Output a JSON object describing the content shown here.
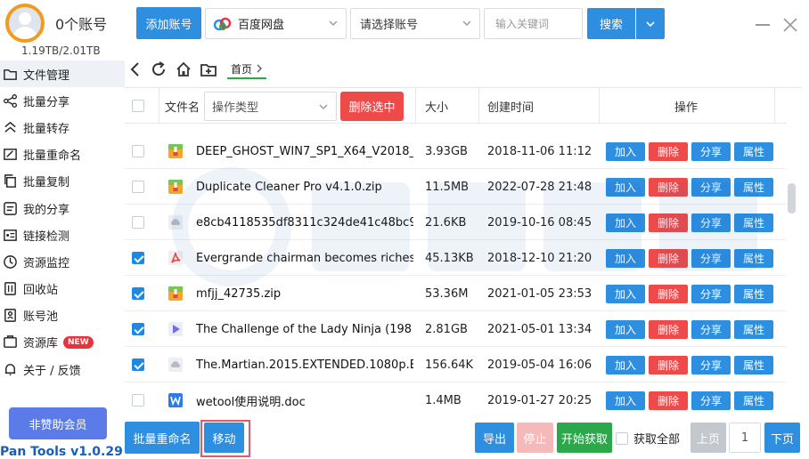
{
  "sidebar": {
    "account_count": "0个账号",
    "storage": "1.19TB/2.01TB",
    "items": [
      {
        "label": "文件管理",
        "icon": "folder-icon"
      },
      {
        "label": "批量分享",
        "icon": "share-icon"
      },
      {
        "label": "批量转存",
        "icon": "transfer-icon"
      },
      {
        "label": "批量重命名",
        "icon": "rename-icon"
      },
      {
        "label": "批量复制",
        "icon": "copy-icon"
      },
      {
        "label": "我的分享",
        "icon": "my-share-icon"
      },
      {
        "label": "链接检测",
        "icon": "link-check-icon"
      },
      {
        "label": "资源监控",
        "icon": "monitor-icon"
      },
      {
        "label": "回收站",
        "icon": "recycle-icon"
      },
      {
        "label": "账号池",
        "icon": "account-pool-icon"
      },
      {
        "label": "资源库",
        "icon": "library-icon",
        "badge": "NEW"
      },
      {
        "label": "关于 / 反馈",
        "icon": "bell-icon"
      }
    ],
    "vip_label": "非赞助会员",
    "version": "Pan Tools v1.0.29"
  },
  "toolbar": {
    "add_account": "添加账号",
    "cloud": "百度网盘",
    "account_placeholder": "请选择账号",
    "keyword_placeholder": "输入关键词",
    "search": "搜索"
  },
  "nav": {
    "breadcrumb": "首页"
  },
  "table": {
    "headers": {
      "filename": "文件名",
      "op_type": "操作类型",
      "delete_selected": "删除选中",
      "size": "大小",
      "created": "创建时间",
      "actions": "操作"
    },
    "action_labels": {
      "add": "加入",
      "delete": "删除",
      "share": "分享",
      "props": "属性"
    },
    "rows": [
      {
        "checked": false,
        "type": "archive",
        "name": "DEEP_GHOST_WIN7_SP1_X64_V2018_",
        "size": "3.93GB",
        "date": "2018-11-06 11:12"
      },
      {
        "checked": false,
        "type": "archive",
        "name": "Duplicate Cleaner Pro v4.1.0.zip",
        "size": "11.5MB",
        "date": "2022-07-28 21:48"
      },
      {
        "checked": false,
        "type": "cloud",
        "name": "e8cb4118535df8311c324de41c48bc9",
        "size": "21.6KB",
        "date": "2019-10-16 08:45"
      },
      {
        "checked": true,
        "type": "pdf",
        "name": "Evergrande chairman becomes riches",
        "size": "45.13KB",
        "date": "2018-12-10 21:20"
      },
      {
        "checked": true,
        "type": "archive",
        "name": "mfjj_42735.zip",
        "size": "53.36M",
        "date": "2021-01-05 23:53"
      },
      {
        "checked": true,
        "type": "video",
        "name": "The Challenge of the Lady Ninja (198",
        "size": "2.81GB",
        "date": "2021-05-01 13:34"
      },
      {
        "checked": true,
        "type": "cloud",
        "name": "The.Martian.2015.EXTENDED.1080p.Bl",
        "size": "156.64K",
        "date": "2019-05-04 16:06"
      },
      {
        "checked": false,
        "type": "word",
        "name": "wetool使用说明.doc",
        "size": "1.4MB",
        "date": "2019-01-27 20:25"
      }
    ]
  },
  "bottom": {
    "bulk_rename": "批量重命名",
    "move": "移动",
    "export": "导出",
    "stop": "停止",
    "start": "开始获取",
    "fetch_all": "获取全部",
    "prev": "上页",
    "page": "1",
    "next": "下页"
  },
  "colors": {
    "primary": "#2e8ee0",
    "danger": "#ee4a4a",
    "success": "#2aa84a",
    "accent": "#f29b21"
  }
}
